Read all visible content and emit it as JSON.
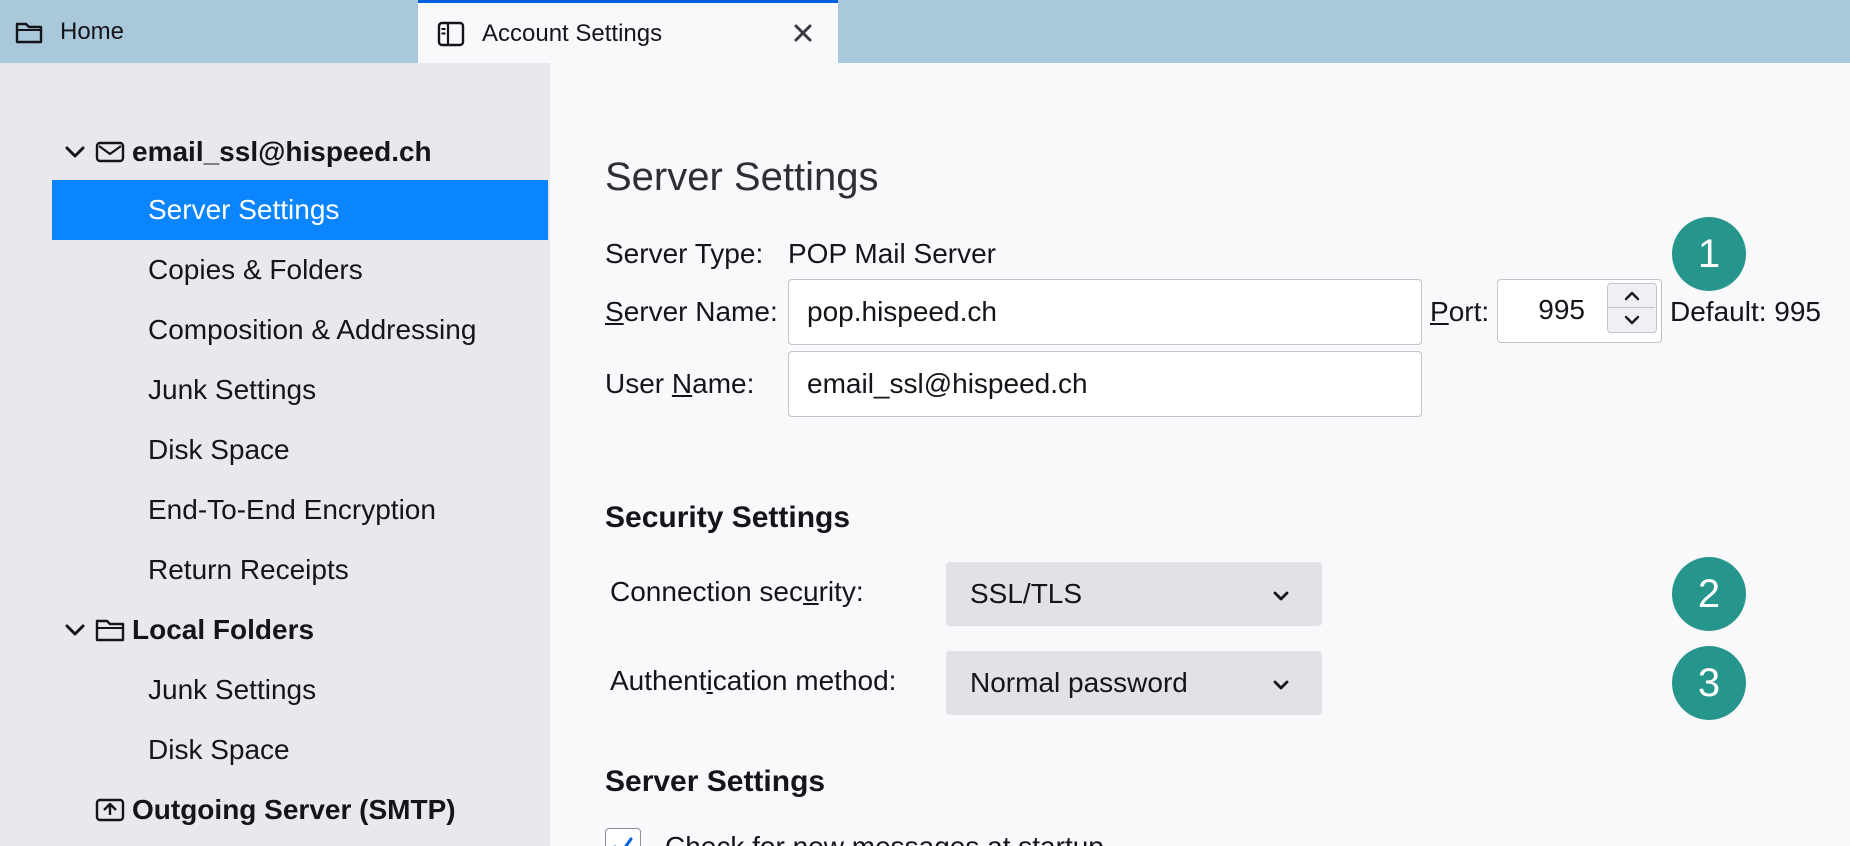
{
  "tabs": [
    {
      "label": "Home",
      "icon": "folder-icon",
      "active": false
    },
    {
      "label": "Account Settings",
      "icon": "account-settings-icon",
      "active": true,
      "closable": true
    }
  ],
  "sidebar": {
    "accounts": [
      {
        "label": "email_ssl@hispeed.ch",
        "icon": "envelope-icon",
        "expanded": true,
        "items": [
          {
            "label": "Server Settings",
            "selected": true
          },
          {
            "label": "Copies & Folders"
          },
          {
            "label": "Composition & Addressing"
          },
          {
            "label": "Junk Settings"
          },
          {
            "label": "Disk Space"
          },
          {
            "label": "End-To-End Encryption"
          },
          {
            "label": "Return Receipts"
          }
        ]
      },
      {
        "label": "Local Folders",
        "icon": "folder-icon",
        "expanded": true,
        "items": [
          {
            "label": "Junk Settings"
          },
          {
            "label": "Disk Space"
          }
        ]
      }
    ],
    "outgoing": {
      "label": "Outgoing Server (SMTP)",
      "icon": "outgoing-server-icon"
    }
  },
  "main": {
    "title": "Server Settings",
    "server_type_label": "Server Type:",
    "server_type_value": "POP Mail Server",
    "server_name_label": "Server Name:",
    "server_name_value": "pop.hispeed.ch",
    "port_label": "Port:",
    "port_value": "995",
    "port_default": "Default: 995",
    "user_name_label": "User Name:",
    "user_name_value": "email_ssl@hispeed.ch",
    "security_heading": "Security Settings",
    "connection_security_label": "Connection security:",
    "connection_security_value": "SSL/TLS",
    "auth_method_label": "Authentication method:",
    "auth_method_value": "Normal password",
    "server_settings_heading": "Server Settings",
    "check_startup_label": "Check for new messages at startup",
    "check_startup_checked": true
  },
  "callouts": [
    "1",
    "2",
    "3"
  ],
  "colors": {
    "tabstrip": "#a9c8da",
    "sidebar": "#e8e8ee",
    "selection": "#0a84ff",
    "badge": "#26968d",
    "dropdown": "#e2e2e6",
    "accent": "#0060df"
  }
}
